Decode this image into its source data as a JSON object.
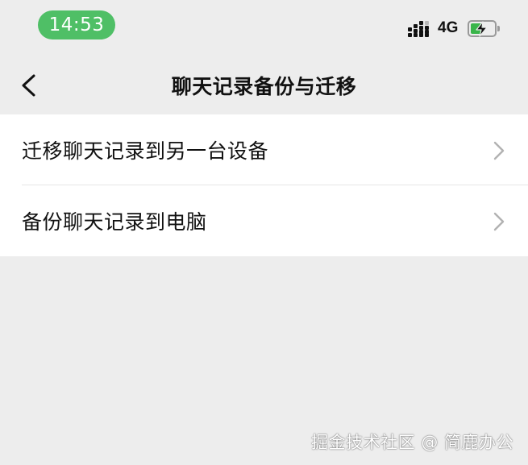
{
  "status_bar": {
    "time": "14:53",
    "network": "4G",
    "battery_level": 0.55,
    "accent_color": "#4fbf66",
    "battery_color": "#39b54a"
  },
  "nav": {
    "back_icon": "chevron-left-icon",
    "title": "聊天记录备份与迁移"
  },
  "list": {
    "items": [
      {
        "label": "迁移聊天记录到另一台设备",
        "icon": "chevron-right-icon"
      },
      {
        "label": "备份聊天记录到电脑",
        "icon": "chevron-right-icon"
      }
    ]
  },
  "watermark": "掘金技术社区 @ 简鹿办公"
}
